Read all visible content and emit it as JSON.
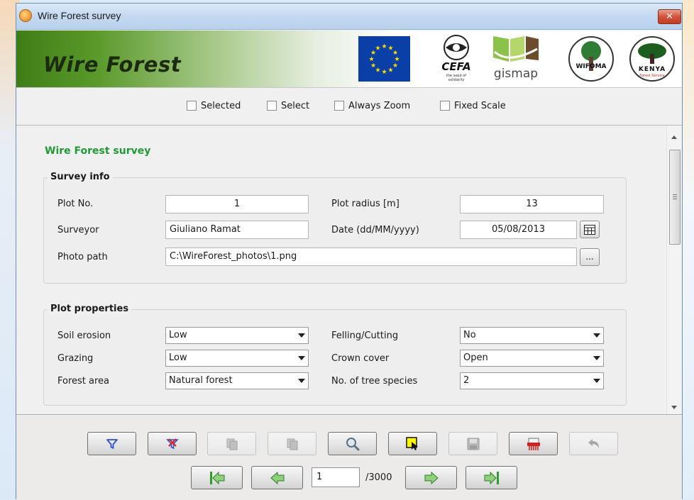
{
  "window": {
    "title": "Wire Forest survey",
    "close_glyph": "✕"
  },
  "banner": {
    "title": "Wire Forest",
    "logos": {
      "cefa": "CEFA",
      "cefa_tagline": "the seed of solidarity",
      "gismap": "gismap",
      "wifoma": "WIFOMA",
      "kenya": "KENYA",
      "kenya_sub": "Forest Service"
    }
  },
  "options": {
    "selected": "Selected",
    "select": "Select",
    "always_zoom": "Always Zoom",
    "fixed_scale": "Fixed Scale"
  },
  "form": {
    "title": "Wire Forest survey",
    "survey_info": {
      "title": "Survey info",
      "plot_no_label": "Plot No.",
      "plot_no": "1",
      "plot_radius_label": "Plot radius [m]",
      "plot_radius": "13",
      "surveyor_label": "Surveyor",
      "surveyor": "Giuliano Ramat",
      "date_label": "Date (dd/MM/yyyy)",
      "date": "05/08/2013",
      "photo_label": "Photo path",
      "photo_path": "C:\\WireForest_photos\\1.png",
      "browse_label": "..."
    },
    "plot_properties": {
      "title": "Plot properties",
      "soil_erosion_label": "Soil erosion",
      "soil_erosion": "Low",
      "felling_label": "Felling/Cutting",
      "felling": "No",
      "grazing_label": "Grazing",
      "grazing": "Low",
      "crown_cover_label": "Crown cover",
      "crown_cover": "Open",
      "forest_area_label": "Forest area",
      "forest_area": "Natural forest",
      "tree_species_label": "No. of tree species",
      "tree_species": "2"
    }
  },
  "toolbar": {
    "buttons": [
      "filter-icon",
      "remove-filter-icon",
      "copy-icon",
      "paste-icon",
      "zoom-icon",
      "select-feature-icon",
      "save-icon",
      "delete-icon",
      "undo-icon"
    ],
    "accent_blue": "#2a4fd6",
    "accent_red": "#d02424",
    "accent_green": "#2f9e2f",
    "accent_yellow": "#ffff00"
  },
  "navigation": {
    "current_page": "1",
    "total": "/3000"
  }
}
